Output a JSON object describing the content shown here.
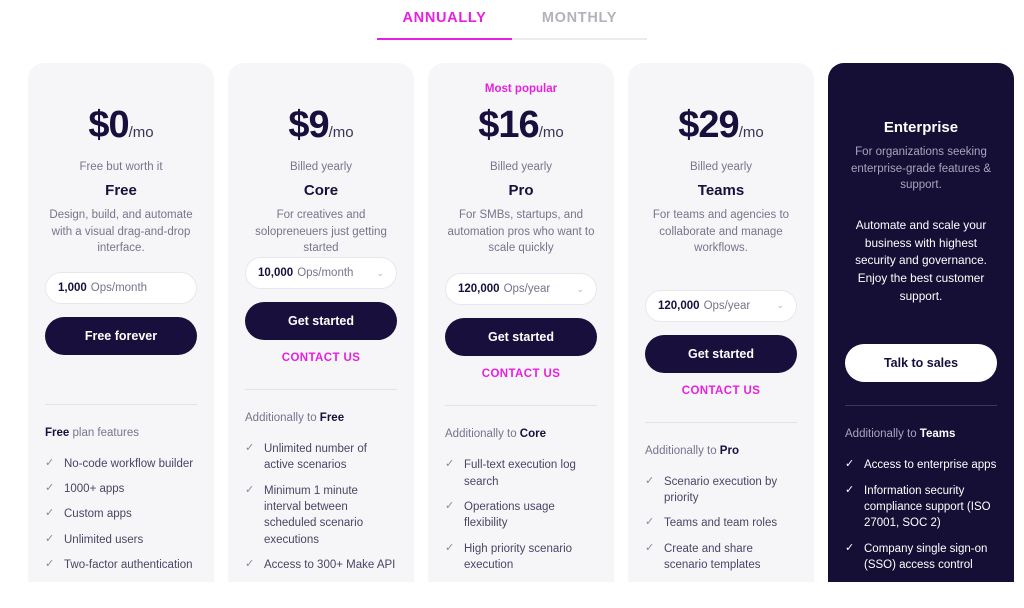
{
  "tabs": [
    {
      "label": "ANNUALLY",
      "active": true
    },
    {
      "label": "MONTHLY",
      "active": false
    }
  ],
  "colors": {
    "accent": "#e81fe0",
    "dark_card": "#150e35",
    "card_bg": "#f6f6f9",
    "text_dark": "#180f3d",
    "text_muted": "#77748b"
  },
  "plans": [
    {
      "badge": "",
      "amount": "$0",
      "per": "/mo",
      "billing_note": "Free but worth it",
      "name": "Free",
      "description": "Design, build, and automate with a visual drag-and-drop interface.",
      "ops_value": "1,000",
      "ops_unit": "Ops/month",
      "has_chevron": false,
      "cta_label": "Free forever",
      "contact_label": "",
      "features_head_prefix": "",
      "features_head_bold": "Free",
      "features_head_suffix": " plan features",
      "features": [
        "No-code workflow builder",
        "1000+ apps",
        "Custom apps",
        "Unlimited users",
        "Two-factor authentication"
      ]
    },
    {
      "badge": "",
      "amount": "$9",
      "per": "/mo",
      "billing_note": "Billed yearly",
      "name": "Core",
      "description": "For creatives and solopreneuers just getting started",
      "ops_value": "10,000",
      "ops_unit": "Ops/month",
      "has_chevron": true,
      "cta_label": "Get started",
      "contact_label": "CONTACT US",
      "features_head_prefix": "Additionally to ",
      "features_head_bold": "Free",
      "features_head_suffix": "",
      "features": [
        "Unlimited number of active scenarios",
        "Minimum 1 minute interval between scheduled scenario executions",
        "Access to 300+ Make API"
      ]
    },
    {
      "badge": "Most popular",
      "amount": "$16",
      "per": "/mo",
      "billing_note": "Billed yearly",
      "name": "Pro",
      "description": "For SMBs, startups, and automation pros who want to scale quickly",
      "ops_value": "120,000",
      "ops_unit": "Ops/year",
      "has_chevron": true,
      "cta_label": "Get started",
      "contact_label": "CONTACT US",
      "features_head_prefix": "Additionally to ",
      "features_head_bold": "Core",
      "features_head_suffix": "",
      "features": [
        "Full-text execution log search",
        "Operations usage flexibility",
        "High priority scenario execution"
      ]
    },
    {
      "badge": "",
      "amount": "$29",
      "per": "/mo",
      "billing_note": "Billed yearly",
      "name": "Teams",
      "description": "For teams and agencies to collaborate and manage workflows.",
      "ops_value": "120,000",
      "ops_unit": "Ops/year",
      "has_chevron": true,
      "cta_label": "Get started",
      "contact_label": "CONTACT US",
      "features_head_prefix": "Additionally to ",
      "features_head_bold": "Pro",
      "features_head_suffix": "",
      "features": [
        "Scenario execution by priority",
        "Teams and team roles",
        "Create and share scenario templates"
      ]
    }
  ],
  "enterprise": {
    "title": "Enterprise",
    "subtitle": "For organizations seeking enterprise-grade features & support.",
    "body": "Automate and scale your business with highest security and governance. Enjoy the best customer support.",
    "cta_label": "Talk to sales",
    "features_head_prefix": "Additionally to ",
    "features_head_bold": "Teams",
    "features_head_suffix": "",
    "features": [
      "Access to enterprise apps",
      "Information security compliance support (ISO 27001, SOC 2)",
      "Company single sign-on (SSO) access control"
    ]
  },
  "icons": {
    "check": "✓",
    "chevron_down": "⌄"
  }
}
